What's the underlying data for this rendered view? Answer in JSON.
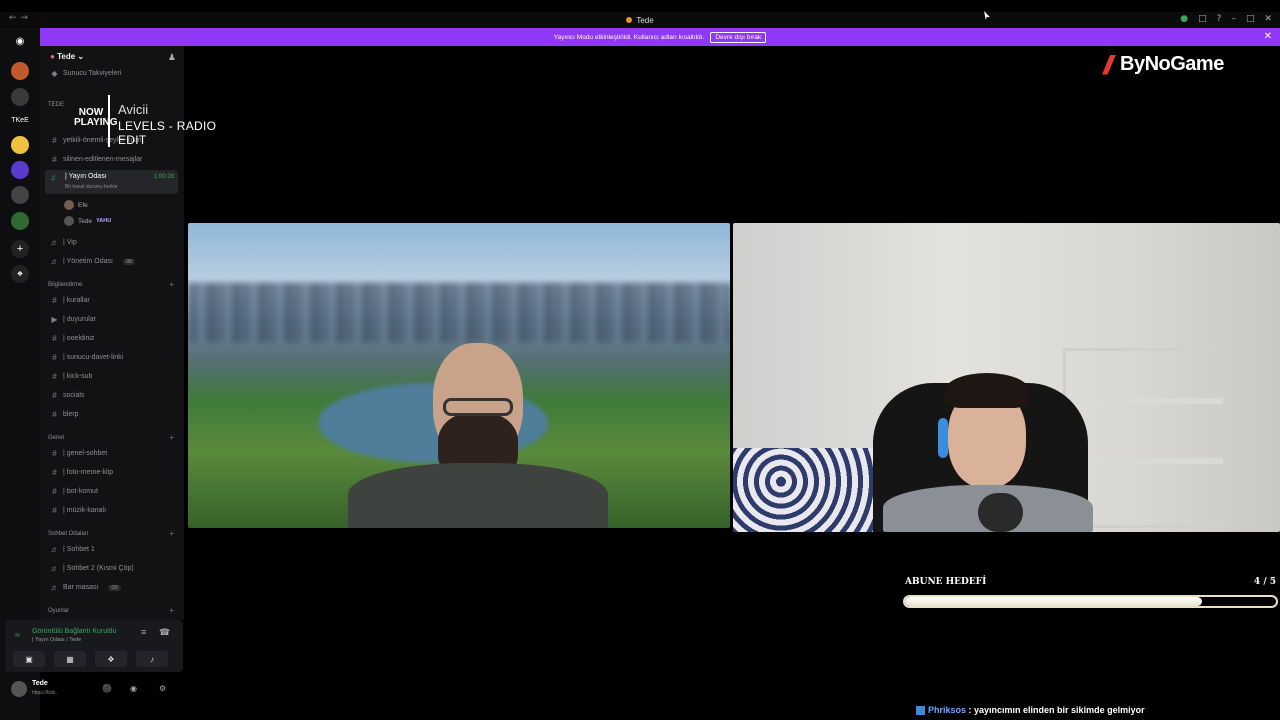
{
  "window": {
    "title": "Tede"
  },
  "banner": {
    "text": "Yayıncı Modu etkinleştirildi. Kullanıcı adları kısaltıldı.",
    "button": "Devre dışı bırak"
  },
  "rail": {
    "letters": "TKeE"
  },
  "sidebar": {
    "guild_name": "Tede",
    "top_item": "Sunucu Takviyeleri",
    "category_tede": "TEDE",
    "channels_top": [
      "yetkili-önemli-şeyler-kısmı",
      "silinen-editlenen-mesajlar"
    ],
    "active_voice": {
      "name": "| Yayın Odası",
      "timer": "1:00:28",
      "status": "Bir kanal durumu belirle"
    },
    "members": [
      {
        "name": "Efe",
        "tag": ""
      },
      {
        "name": "Tede",
        "tag": "YAHU"
      }
    ],
    "voice_more": [
      {
        "name": "| Vip",
        "pill": ""
      },
      {
        "name": "| Yönetim Odası",
        "pill": "00"
      }
    ],
    "cat_info": "Bilgilendirme",
    "info_channels": [
      "| kurallar",
      "| duyurular",
      "| ooeldiniz",
      "| sunucu-davet-linki",
      "| kick-sub",
      "socials",
      "blerp"
    ],
    "cat_general": "Genel",
    "general_channels": [
      "| genel-sohbet",
      "| foto-meme-klip",
      "| bot-komut",
      "| müzik-kanalı"
    ],
    "cat_chat_rooms": "Sohbet Odaları",
    "chat_rooms": [
      "| Sohbet 1",
      "| Sohbet 2 (Kısmi Çöp)",
      "Bar masası"
    ],
    "bar_pill": "00",
    "cat_games": "Oyunlar"
  },
  "voice_panel": {
    "status": "Görüntülü Bağlantı Kuruldu",
    "location": "| Yayın Odası / Tede"
  },
  "user": {
    "name": "Tede",
    "status": "https://kick."
  },
  "now_playing": {
    "label": "NOW PLAYING",
    "artist": "Avicii",
    "track": "LEVELS - RADIO EDIT"
  },
  "brand": {
    "logo_text": "ByNoGame",
    "accent": "#8f38f5",
    "online": "#3ba55c"
  },
  "goal": {
    "title": "ABUNE HEDEFİ",
    "count": "4 / 5",
    "progress": 0.8
  },
  "chat_message": {
    "user": "Phriksos",
    "text": " : yayıncımın elinden bir sikimde gelmiyor"
  }
}
